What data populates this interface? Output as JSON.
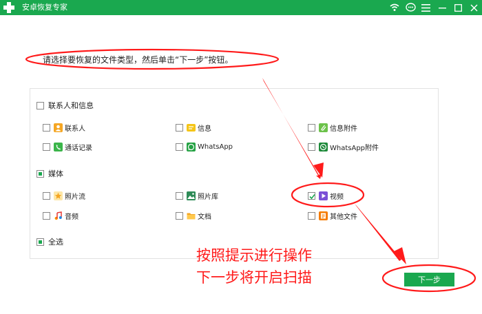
{
  "window": {
    "title": "安卓恢复专家",
    "controls": [
      "wifi-icon",
      "chat-icon",
      "menu-icon",
      "minimize-icon",
      "maximize-icon",
      "close-icon"
    ]
  },
  "instruction": "请选择要恢复的文件类型，然后单击“下一步”按钮。",
  "groups": {
    "contacts_messages": {
      "label": "联系人和信息",
      "items": {
        "contacts": "联系人",
        "messages": "信息",
        "message_attachments": "信息附件",
        "call_log": "通话记录",
        "whatsapp": "WhatsApp",
        "whatsapp_attachments": "WhatsApp附件"
      }
    },
    "media": {
      "label": "媒体",
      "items": {
        "camera_roll": "照片流",
        "photo_library": "照片库",
        "video": "视频",
        "audio": "音频",
        "documents": "文档",
        "other_files": "其他文件"
      }
    },
    "select_all": {
      "label": "全选"
    }
  },
  "checked": {
    "media_partial": true,
    "video": true,
    "select_all_partial": true
  },
  "next_button": "下一步",
  "annotations": {
    "line1": "按照提示进行操作",
    "line2": "下一步将开启扫描"
  },
  "colors": {
    "brand_green": "#1aa84f",
    "annotation_red": "#ff1a1a"
  }
}
